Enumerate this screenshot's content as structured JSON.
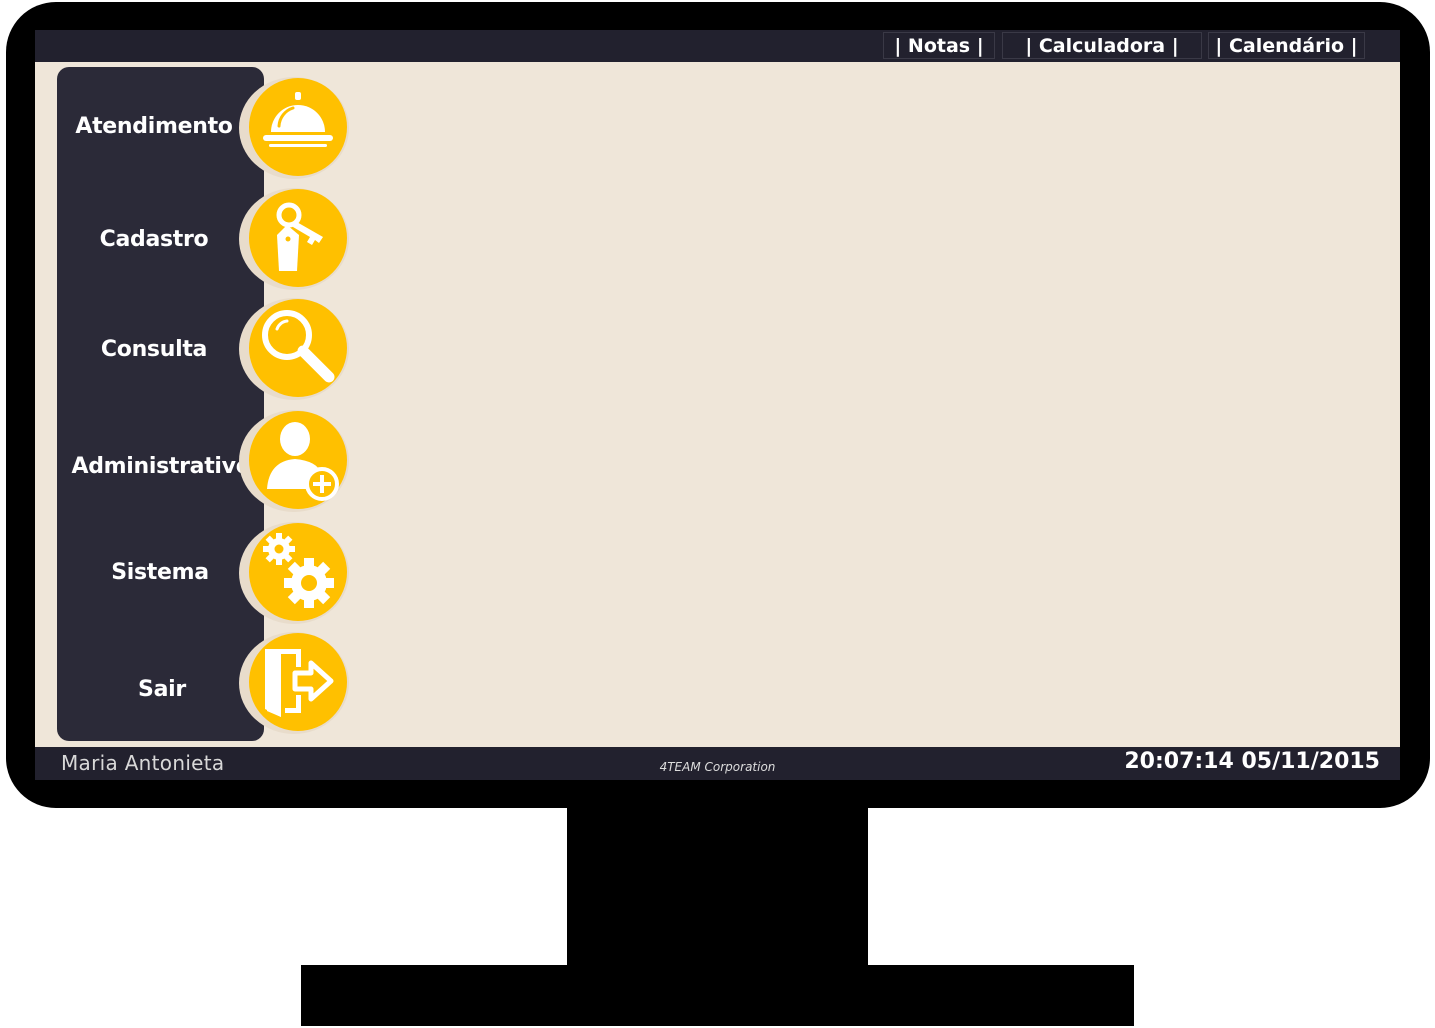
{
  "topbar": {
    "links": [
      {
        "label": "| Notas |"
      },
      {
        "label": "| Calculadora |"
      },
      {
        "label": "| Calendário |"
      }
    ]
  },
  "menu": {
    "items": [
      {
        "label": "Atendimento",
        "icon": "service-bell-icon"
      },
      {
        "label": "Cadastro",
        "icon": "key-tag-icon"
      },
      {
        "label": "Consulta",
        "icon": "magnifier-icon"
      },
      {
        "label": "Administrativo",
        "icon": "user-add-icon"
      },
      {
        "label": "Sistema",
        "icon": "gears-icon"
      },
      {
        "label": "Sair",
        "icon": "exit-door-icon"
      }
    ]
  },
  "footer": {
    "user": "Maria Antonieta",
    "company": "4TEAM Corporation",
    "datetime": "20:07:14 05/11/2015"
  },
  "colors": {
    "bar": "#22212e",
    "sidebar": "#2b2a38",
    "background": "#efe6d9",
    "accent": "#ffc000"
  }
}
